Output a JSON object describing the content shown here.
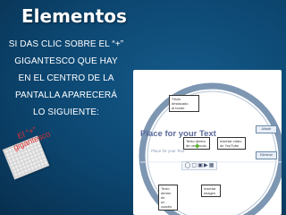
{
  "heading": {
    "title": "Elementos"
  },
  "instructions": {
    "lines": [
      "SI DAS CLIC SOBRE EL “+”",
      "GIGANTESCO QUE HAY",
      "EN EL  CENTRO DE LA",
      "PANTALLA APARECERÁ",
      "LO SIGUIENTE:"
    ]
  },
  "slide": {
    "place_text_title": "Place for your Text",
    "place_text_small": "Place for your Text",
    "callouts": {
      "title_destacado": "Título destacado\nal borde",
      "texto_circulo": "Texto dentro\nde un círculo",
      "insertar_video": "Insertar vídeo\nde YouTube",
      "texto_cuadro": "Texto\ndentro de\nun cuadro",
      "insertar_imagen": "Insertar\nimagen"
    },
    "buttons": {
      "anadir": "Añadir",
      "eliminar": "Eliminar"
    },
    "toolbar_icons": [
      "text-circle-icon",
      "text-box-icon",
      "image-icon",
      "video-icon",
      "video-alt-icon"
    ],
    "sticky_note": "El \"+\"\ngigantesco"
  },
  "colors": {
    "background": "#0d3f66",
    "place_text": "#5a6a9a",
    "sticky_text": "#e03131",
    "spark": "#57b430"
  }
}
